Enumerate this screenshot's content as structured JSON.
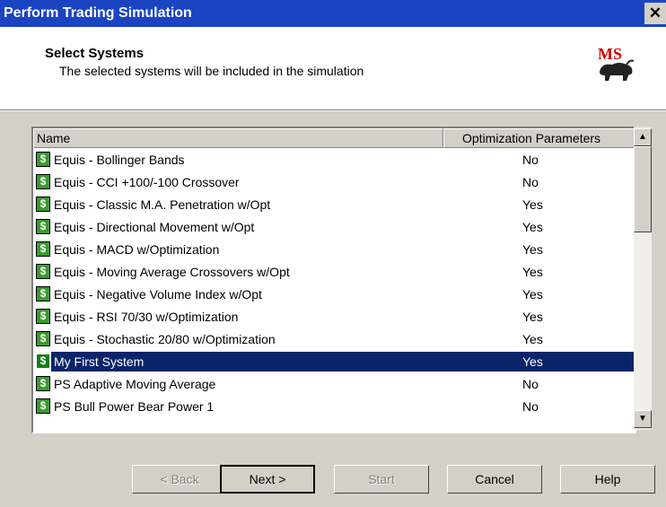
{
  "window": {
    "title": "Perform Trading Simulation",
    "close_glyph": "✕"
  },
  "header": {
    "title": "Select Systems",
    "subtitle": "The selected systems will be included in the simulation",
    "logo_text": "MS"
  },
  "list": {
    "columns": {
      "name": "Name",
      "opt": "Optimization Parameters"
    },
    "rows": [
      {
        "name": "Equis - Bollinger Bands",
        "opt": "No"
      },
      {
        "name": "Equis - CCI +100/-100 Crossover",
        "opt": "No"
      },
      {
        "name": "Equis - Classic M.A. Penetration  w/Opt",
        "opt": "Yes"
      },
      {
        "name": "Equis - Directional Movement  w/Opt",
        "opt": "Yes"
      },
      {
        "name": "Equis - MACD  w/Optimization",
        "opt": "Yes"
      },
      {
        "name": "Equis - Moving Average Crossovers w/Opt",
        "opt": "Yes"
      },
      {
        "name": "Equis - Negative Volume Index  w/Opt",
        "opt": "Yes"
      },
      {
        "name": "Equis - RSI 70/30 w/Optimization",
        "opt": "Yes"
      },
      {
        "name": "Equis - Stochastic 20/80  w/Optimization",
        "opt": "Yes"
      },
      {
        "name": "My First System",
        "opt": "Yes"
      },
      {
        "name": "PS Adaptive Moving Average",
        "opt": "No"
      },
      {
        "name": "PS Bull Power Bear Power 1",
        "opt": "No"
      }
    ],
    "selected_row": "My First System",
    "row_icon": "$"
  },
  "buttons": {
    "back": "< Back",
    "next": "Next >",
    "start": "Start",
    "cancel": "Cancel",
    "help": "Help"
  },
  "colors": {
    "titlebar": "#1a44c2",
    "selection": "#0a246a",
    "dialog": "#d4d0c8"
  }
}
